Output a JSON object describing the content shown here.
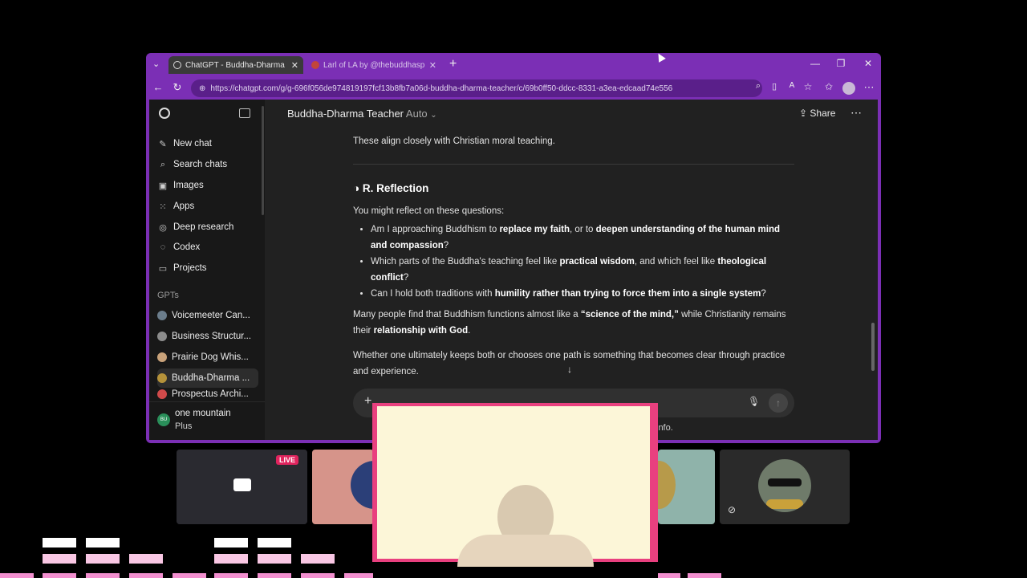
{
  "browser": {
    "tabs": [
      {
        "label": "ChatGPT - Buddha-Dharma Teacher",
        "close": "✕"
      },
      {
        "label": "Larl of LA by @thebuddhaspriest",
        "close": "✕"
      }
    ],
    "new_tab": "+",
    "url": "https://chatgpt.com/g/g-696f056de974819197fcf13b8fb7a06d-buddha-dharma-teacher/c/69b0ff50-ddcc-8331-a3ea-edcaad74e556"
  },
  "sidebar": {
    "items": [
      {
        "label": "New chat",
        "icon": "✎"
      },
      {
        "label": "Search chats",
        "icon": "⌕"
      },
      {
        "label": "Images",
        "icon": "▣"
      },
      {
        "label": "Apps",
        "icon": "⁙"
      },
      {
        "label": "Deep research",
        "icon": "◎"
      },
      {
        "label": "Codex",
        "icon": "◌"
      },
      {
        "label": "Projects",
        "icon": "▭"
      }
    ],
    "gpts_heading": "GPTs",
    "gpts": [
      {
        "label": "Voicemeeter Can...",
        "color": "#6b7d8c"
      },
      {
        "label": "Business Structur...",
        "color": "#8c8c8c"
      },
      {
        "label": "Prairie Dog Whis...",
        "color": "#c9a27a"
      },
      {
        "label": "Buddha-Dharma ...",
        "color": "#b5923a"
      },
      {
        "label": "Prospectus Archi...",
        "color": "#d04a4a"
      }
    ],
    "user": {
      "name": "one mountain",
      "plan": "Plus",
      "initials": "BU"
    }
  },
  "header": {
    "title": "Buddha-Dharma Teacher",
    "model": "Auto",
    "share": "Share"
  },
  "chat": {
    "line_top": "These align closely with Christian moral teaching.",
    "section_heading": "R. Reflection",
    "intro": "You might reflect on these questions:",
    "b1_pre": "Am I approaching Buddhism to ",
    "b1_bold1": "replace my faith",
    "b1_mid": ", or to ",
    "b1_bold2": "deepen understanding of the human mind and compassion",
    "b1_end": "?",
    "b2_pre": "Which parts of the Buddha's teaching feel like ",
    "b2_bold1": "practical wisdom",
    "b2_mid": ", and which feel like ",
    "b2_bold2": "theological conflict",
    "b2_end": "?",
    "b3_pre": "Can I hold both traditions with ",
    "b3_bold": "humility rather than trying to force them into a single system",
    "b3_end": "?",
    "p1_pre": "Many people find that Buddhism functions almost like a ",
    "p1_bold1": "“science of the mind,”",
    "p1_mid": " while Christianity remains their ",
    "p1_bold2": "relationship with God",
    "p1_end": ".",
    "p2": "Whether one ultimately keeps both or chooses one path is something that becomes clear through practice and experience.",
    "disclaimer_tail": "info."
  },
  "stream": {
    "live_badge": "LIVE"
  }
}
